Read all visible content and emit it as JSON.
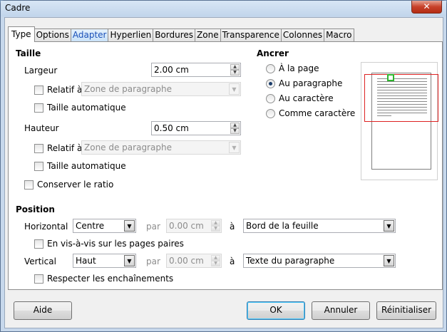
{
  "window": {
    "title": "Cadre",
    "close_glyph": "✕"
  },
  "tabs": [
    {
      "label": "Type",
      "active": true
    },
    {
      "label": "Options"
    },
    {
      "label": "Adapter"
    },
    {
      "label": "Hyperlien"
    },
    {
      "label": "Bordures"
    },
    {
      "label": "Zone"
    },
    {
      "label": "Transparence"
    },
    {
      "label": "Colonnes"
    },
    {
      "label": "Macro"
    }
  ],
  "size": {
    "heading": "Taille",
    "width_label": "Largeur",
    "width_value": "2.00 cm",
    "width_relative_label": "Relatif à",
    "width_relative_option": "Zone de paragraphe",
    "width_auto_label": "Taille automatique",
    "height_label": "Hauteur",
    "height_value": "0.50 cm",
    "height_relative_label": "Relatif à",
    "height_relative_option": "Zone de paragraphe",
    "height_auto_label": "Taille automatique",
    "keep_ratio_label": "Conserver le ratio"
  },
  "anchor": {
    "heading": "Ancrer",
    "options": [
      "À la page",
      "Au paragraphe",
      "Au caractère",
      "Comme caractère"
    ],
    "selected": "Au paragraphe"
  },
  "position": {
    "heading": "Position",
    "horizontal_label": "Horizontal",
    "horizontal_value": "Centre",
    "horizontal_by_label": "par",
    "horizontal_by_value": "0.00 cm",
    "horizontal_to_label": "à",
    "horizontal_to_value": "Bord de la feuille",
    "mirror_label": "En vis-à-vis sur les pages paires",
    "vertical_label": "Vertical",
    "vertical_value": "Haut",
    "vertical_by_label": "par",
    "vertical_by_value": "0.00 cm",
    "vertical_to_label": "à",
    "vertical_to_value": "Texte du paragraphe",
    "follow_flow_label": "Respecter les enchaînements"
  },
  "buttons": {
    "help": "Aide",
    "ok": "OK",
    "cancel": "Annuler",
    "reset": "Réinitialiser"
  },
  "icons": {
    "spin_up": "▲",
    "spin_down": "▼",
    "drop": "▼"
  },
  "colors": {
    "anchor_outline": "#dd2222",
    "frame_marker": "#2db52d",
    "title_bar": "#c7d8ec"
  }
}
